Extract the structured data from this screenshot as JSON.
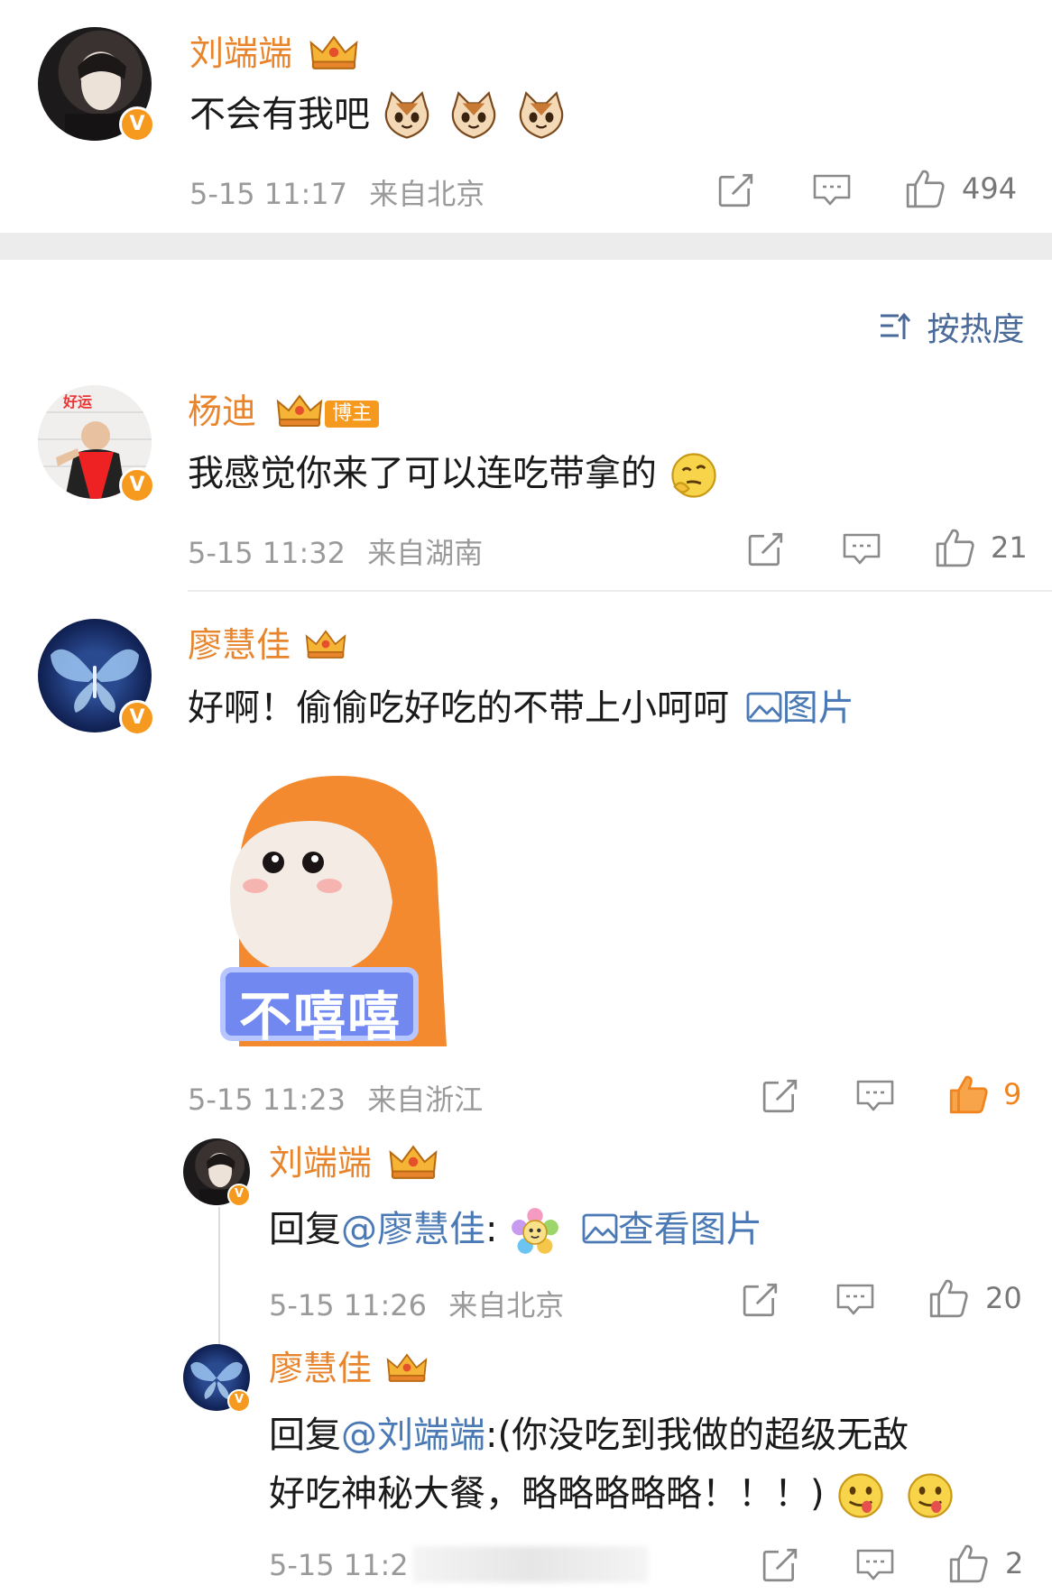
{
  "comments": [
    {
      "user": "刘端端",
      "text": "不会有我吧",
      "time": "5-15 11:17",
      "location": "来自北京",
      "likes": "494"
    },
    {
      "user": "杨迪",
      "badge": "博主",
      "text": "我感觉你来了可以连吃带拿的",
      "time": "5-15 11:32",
      "location": "来自湖南",
      "likes": "21"
    },
    {
      "user": "廖慧佳",
      "text": "好啊！偷偷吃好吃的不带上小呵呵",
      "image_link": "图片",
      "sticker_text": "不嘻嘻",
      "time": "5-15 11:23",
      "location": "来自浙江",
      "likes": "9"
    }
  ],
  "sort_label": "按热度",
  "replies": [
    {
      "user": "刘端端",
      "prefix": "回复",
      "mention": "@廖慧佳",
      "colon": ":",
      "image_link": "查看图片",
      "time": "5-15 11:26",
      "location": "来自北京",
      "likes": "20"
    },
    {
      "user": "廖慧佳",
      "prefix": "回复",
      "mention": "@刘端端",
      "text_line1": ":(你没吃到我做的超级无敌",
      "text_line2": "好吃神秘大餐，略略略略略！！！)",
      "time": "5-15 11:2",
      "likes": "2"
    }
  ],
  "colors": {
    "name": "#e8842c",
    "link": "#4a79b5",
    "meta": "#9a9a9a",
    "liked": "#f0841e"
  },
  "icons": [
    "crown-icon",
    "verified-icon",
    "share-icon",
    "comment-icon",
    "like-icon",
    "image-icon",
    "sort-icon"
  ]
}
